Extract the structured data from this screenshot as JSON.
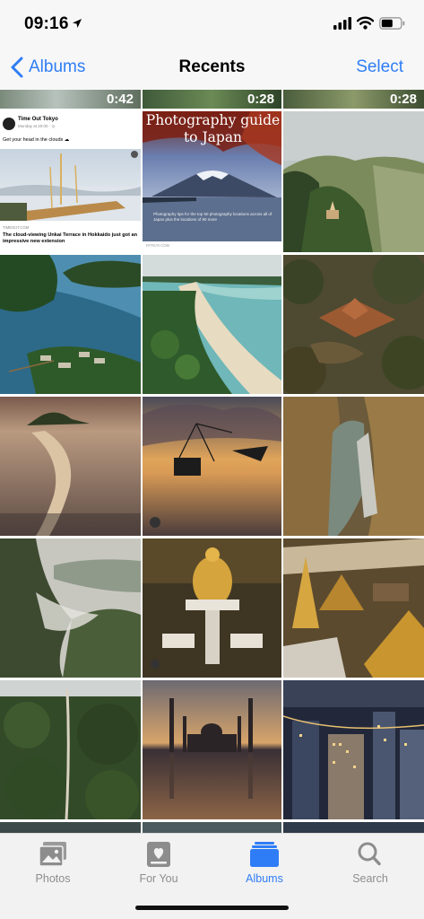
{
  "status_bar": {
    "time": "09:16"
  },
  "nav": {
    "back_label": "Albums",
    "title": "Recents",
    "select_label": "Select"
  },
  "videos": {
    "d1": "0:42",
    "d2": "0:28",
    "d3": "0:28"
  },
  "timeout_card": {
    "name": "Time Out Tokyo",
    "date": "Monday at 20:00 · ◎",
    "text": "Get your head in the clouds ☁",
    "source": "TIMEOUT.COM",
    "headline": "The cloud-viewing Unkai Terrace in Hokkaido just got an impressive new extension"
  },
  "japan_card": {
    "title": "Photography guide to Japan",
    "subtitle": "Photography tips for the top 50 photography locations across all of Japan plus the locations of 90 more",
    "source": "PATKAY.COM"
  },
  "tabs": [
    {
      "label": "Photos",
      "icon": "photos-icon"
    },
    {
      "label": "For You",
      "icon": "for-you-icon"
    },
    {
      "label": "Albums",
      "icon": "albums-icon"
    },
    {
      "label": "Search",
      "icon": "search-icon"
    }
  ],
  "colors": {
    "accent": "#2f7df6",
    "inactive": "#8d8d8d",
    "bar": "#f7f7f7"
  }
}
